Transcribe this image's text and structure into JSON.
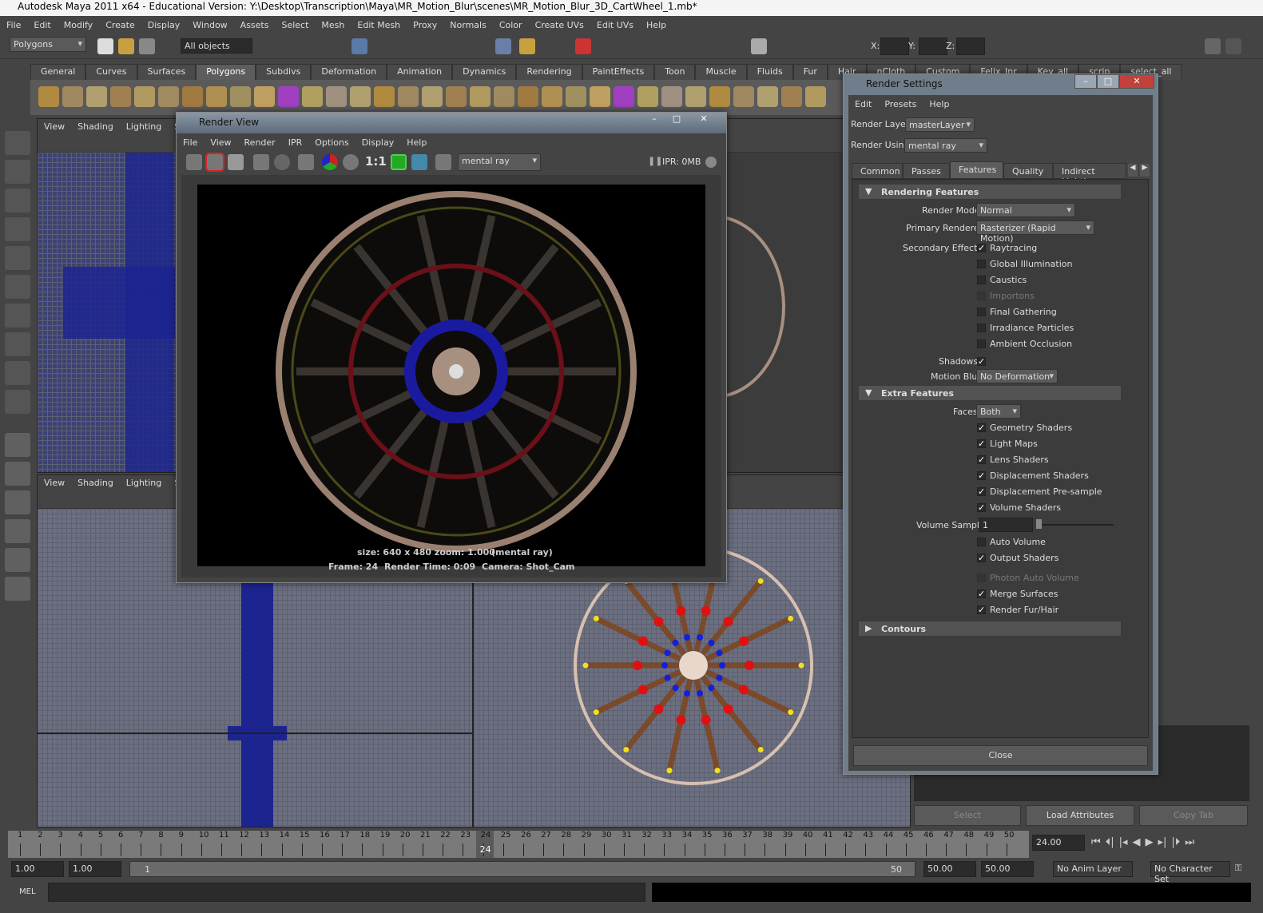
{
  "window_title": "Autodesk Maya 2011 x64 - Educational Version: Y:\\Desktop\\Transcription\\Maya\\MR_Motion_Blur\\scenes\\MR_Motion_Blur_3D_CartWheel_1.mb*",
  "menubar": [
    "File",
    "Edit",
    "Modify",
    "Create",
    "Display",
    "Window",
    "Assets",
    "Select",
    "Mesh",
    "Edit Mesh",
    "Proxy",
    "Normals",
    "Color",
    "Create UVs",
    "Edit UVs",
    "Help"
  ],
  "toolbar": {
    "menu_set": "Polygons",
    "selection_field": "All objects",
    "x_label": "X:",
    "y_label": "Y:",
    "z_label": "Z:"
  },
  "shelf_tabs": [
    "General",
    "Curves",
    "Surfaces",
    "Polygons",
    "Subdivs",
    "Deformation",
    "Animation",
    "Dynamics",
    "Rendering",
    "PaintEffects",
    "Toon",
    "Muscle",
    "Fluids",
    "Fur",
    "Hair",
    "nCloth",
    "Custom",
    "Felix_Jnr",
    "Key_all",
    "scrip",
    "select_all"
  ],
  "shelf_active": "Polygons",
  "viewport_menu": [
    "View",
    "Shading",
    "Lighting",
    "Show"
  ],
  "render_view": {
    "title": "Render View",
    "menu": [
      "File",
      "View",
      "Render",
      "IPR",
      "Options",
      "Display",
      "Help"
    ],
    "ratio": "1:1",
    "renderer": "mental ray",
    "ipr": "IPR: 0MB",
    "caption_line1": "size: 640 x 480 zoom: 1.000",
    "caption_renderer": "(mental ray)",
    "frame": "Frame: 24",
    "render_time": "Render Time: 0:09",
    "camera": "Camera: Shot_Cam"
  },
  "render_settings": {
    "title": "Render Settings",
    "menu": [
      "Edit",
      "Presets",
      "Help"
    ],
    "render_layer_label": "Render Layer",
    "render_layer": "masterLayer",
    "render_using_label": "Render Using",
    "render_using": "mental ray",
    "tabs": [
      "Common",
      "Passes",
      "Features",
      "Quality",
      "Indirect Lighting"
    ],
    "active_tab": "Features",
    "rendering_features": "Rendering Features",
    "render_mode_label": "Render Mode",
    "render_mode": "Normal",
    "primary_renderer_label": "Primary Renderer",
    "primary_renderer": "Rasterizer (Rapid Motion)",
    "secondary_effects_label": "Secondary Effects",
    "secondary_effects": [
      {
        "label": "Raytracing",
        "checked": true,
        "enabled": true
      },
      {
        "label": "Global Illumination",
        "checked": false,
        "enabled": true
      },
      {
        "label": "Caustics",
        "checked": false,
        "enabled": true
      },
      {
        "label": "Importons",
        "checked": false,
        "enabled": false
      },
      {
        "label": "Final Gathering",
        "checked": false,
        "enabled": true
      },
      {
        "label": "Irradiance Particles",
        "checked": false,
        "enabled": true
      },
      {
        "label": "Ambient Occlusion",
        "checked": false,
        "enabled": true
      }
    ],
    "shadows_label": "Shadows",
    "shadows": true,
    "motion_blur_label": "Motion Blur",
    "motion_blur": "No Deformation",
    "extra_features": "Extra Features",
    "faces_label": "Faces",
    "faces": "Both",
    "extra_checks": [
      {
        "label": "Geometry Shaders",
        "checked": true,
        "enabled": true
      },
      {
        "label": "Light Maps",
        "checked": true,
        "enabled": true
      },
      {
        "label": "Lens Shaders",
        "checked": true,
        "enabled": true
      },
      {
        "label": "Displacement Shaders",
        "checked": true,
        "enabled": true
      },
      {
        "label": "Displacement Pre-sample",
        "checked": true,
        "enabled": true
      },
      {
        "label": "Volume Shaders",
        "checked": true,
        "enabled": true
      }
    ],
    "volume_samples_label": "Volume Samples",
    "volume_samples": "1",
    "extra_checks2": [
      {
        "label": "Auto Volume",
        "checked": false,
        "enabled": true
      },
      {
        "label": "Output Shaders",
        "checked": true,
        "enabled": true
      }
    ],
    "extra_checks3": [
      {
        "label": "Photon Auto Volume",
        "checked": false,
        "enabled": false
      },
      {
        "label": "Merge Surfaces",
        "checked": true,
        "enabled": true
      },
      {
        "label": "Render Fur/Hair",
        "checked": true,
        "enabled": true
      }
    ],
    "contours": "Contours",
    "close": "Close"
  },
  "attribute_editor": {
    "select": "Select",
    "load_attributes": "Load Attributes",
    "copy_tab": "Copy Tab"
  },
  "timeline": {
    "frames": [
      1,
      2,
      3,
      4,
      5,
      6,
      7,
      8,
      9,
      10,
      11,
      12,
      13,
      14,
      15,
      16,
      17,
      18,
      19,
      20,
      21,
      22,
      23,
      24,
      25,
      26,
      27,
      28,
      29,
      30,
      31,
      32,
      33,
      34,
      35,
      36,
      37,
      38,
      39,
      40,
      41,
      42,
      43,
      44,
      45,
      46,
      47,
      48,
      49,
      50
    ],
    "current_frame": "24",
    "current_time": "24.00"
  },
  "range": {
    "start": "1.00",
    "playback_start": "1.00",
    "slider_start": "1",
    "slider_end": "50",
    "playback_end": "50.00",
    "end": "50.00",
    "anim_layer": "No Anim Layer",
    "character_set": "No Character Set"
  },
  "command_line": {
    "label": "MEL"
  }
}
